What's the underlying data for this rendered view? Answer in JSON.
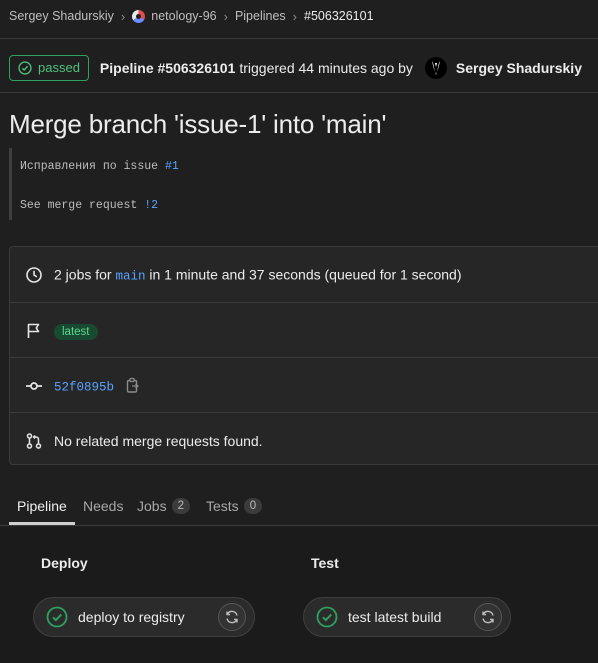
{
  "breadcrumb": {
    "items": [
      "Sergey Shadurskiy",
      "netology-96",
      "Pipelines",
      "#506326101"
    ]
  },
  "header": {
    "status": "passed",
    "pipeline_label": "Pipeline #506326101",
    "triggered_text": "triggered 44 minutes ago by",
    "user": "Sergey Shadurskiy"
  },
  "title": "Merge branch 'issue-1' into 'main'",
  "description": {
    "line1_text": "Исправления по issue ",
    "line1_link": "#1",
    "line2_text": "See merge request ",
    "line2_link": "!2"
  },
  "info": {
    "jobs_prefix": "2 jobs for ",
    "branch": "main",
    "jobs_suffix": " in 1 minute and 37 seconds (queued for 1 second)",
    "tag": "latest",
    "commit": "52f0895b",
    "merge_requests": "No related merge requests found."
  },
  "tabs": [
    {
      "label": "Pipeline",
      "active": true
    },
    {
      "label": "Needs"
    },
    {
      "label": "Jobs",
      "count": "2"
    },
    {
      "label": "Tests",
      "count": "0"
    }
  ],
  "stages": [
    {
      "name": "Deploy",
      "job": "deploy to registry"
    },
    {
      "name": "Test",
      "job": "test latest build"
    }
  ],
  "colors": {
    "success": "#2da160",
    "link": "#5aa3ff"
  },
  "icons": [
    "project-icon",
    "check-circle-icon",
    "clock-icon",
    "flag-icon",
    "commit-icon",
    "copy-icon",
    "merge-request-icon",
    "retry-icon"
  ]
}
